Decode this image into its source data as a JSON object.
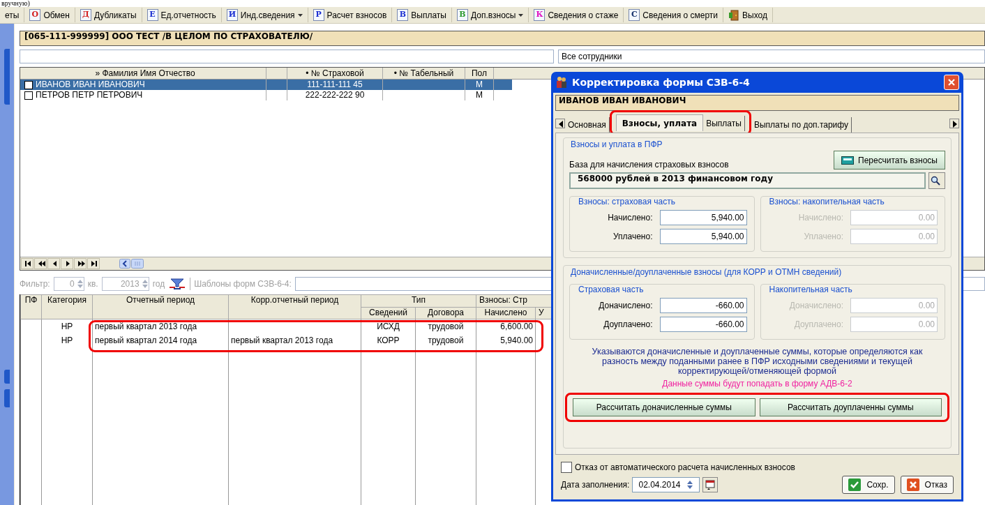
{
  "document_text": "вручную)",
  "toolbar": [
    {
      "kind": "text",
      "label": "еты"
    },
    {
      "kind": "letter",
      "icon_letter": "О",
      "color": "#d42020",
      "label": "Обмен",
      "dropdown": false
    },
    {
      "kind": "letter",
      "icon_letter": "Д",
      "color": "#d42020",
      "label": "Дубликаты",
      "dropdown": false
    },
    {
      "kind": "letter",
      "icon_letter": "Е",
      "color": "#1c2fd0",
      "label": "Ед.отчетность",
      "dropdown": false
    },
    {
      "kind": "letter",
      "icon_letter": "И",
      "color": "#1c2fd0",
      "label": "Инд.сведения",
      "dropdown": true
    },
    {
      "kind": "letter",
      "icon_letter": "Р",
      "color": "#1c2fd0",
      "label": "Расчет взносов",
      "dropdown": false
    },
    {
      "kind": "letter",
      "icon_letter": "В",
      "color": "#1c2fd0",
      "label": "Выплаты",
      "dropdown": false
    },
    {
      "kind": "letter",
      "icon_letter": "В",
      "color": "#2e9a2e",
      "label": "Доп.взносы",
      "dropdown": true
    },
    {
      "kind": "letter",
      "icon_letter": "К",
      "color": "#e010c0",
      "label": "Сведения о стаже",
      "dropdown": false
    },
    {
      "kind": "letter",
      "icon_letter": "С",
      "color": "#14306a",
      "label": "Сведения о смерти",
      "dropdown": false
    },
    {
      "kind": "exit",
      "label": "Выход"
    }
  ],
  "employer_title": "[065-111-999999] ООО ТЕСТ /В ЦЕЛОМ ПО СТРАХОВАТЕЛЮ/",
  "employee_filter": {
    "value": "Все сотрудники"
  },
  "employees": {
    "columns": [
      "» Фамилия Имя Отчество",
      "",
      "• № Страховой",
      "• № Табельный",
      "Пол"
    ],
    "rows": [
      {
        "checked": false,
        "selected": true,
        "name": "ИВАНОВ ИВАН ИВАНОВИЧ",
        "snils": "111-111-111 45",
        "sex": "М"
      },
      {
        "checked": false,
        "selected": false,
        "name": "ПЕТРОВ ПЕТР ПЕТРОВИЧ",
        "snils": "222-222-222 90",
        "sex": "М"
      }
    ]
  },
  "forms_filter": {
    "filter_label": "Фильтр:",
    "quarter": "0",
    "quarter_label": "кв.",
    "year": "2013",
    "year_label": "год",
    "templates_label": "Шаблоны форм СЗВ-6-4:"
  },
  "forms": {
    "header_top": [
      "ПФ",
      "Категория",
      "Отчетный период",
      "Корр.отчетный период",
      "Тип",
      "Взносы: Стр"
    ],
    "header_sub": [
      "Сведений",
      "Договора",
      "Начислено",
      "У"
    ],
    "rows": [
      {
        "category": "НР",
        "period": "первый квартал 2013 года",
        "corr_period": "",
        "info_type": "ИСХД",
        "contract": "трудовой",
        "accrued": "6,600.00"
      },
      {
        "category": "НР",
        "period": "первый квартал 2014 года",
        "corr_period": "первый квартал 2013 года",
        "info_type": "КОРР",
        "contract": "трудовой",
        "accrued": "5,940.00"
      }
    ]
  },
  "dialog": {
    "title": "Корректировка формы СЗВ-6-4",
    "person": "ИВАНОВ ИВАН ИВАНОВИЧ",
    "tabs": [
      {
        "label": "Основная",
        "selected": false
      },
      {
        "label": "Взносы, уплата",
        "selected": true
      },
      {
        "label": "Выплаты",
        "selected": false
      },
      {
        "label": "Выплаты по доп.тарифу",
        "selected": false
      }
    ],
    "pfr_group": {
      "title": "Взносы и уплата в ПФР",
      "recalc_button": "Пересчитать взносы",
      "base_label": "База для начисления страховых взносов",
      "base_value": "568000 рублей в 2013 финансовом году",
      "groups": [
        {
          "title": "Взносы: страховая часть",
          "fields": [
            {
              "label": "Начислено:",
              "value": "5,940.00",
              "disabled": false
            },
            {
              "label": "Уплачено:",
              "value": "5,940.00",
              "disabled": false
            }
          ]
        },
        {
          "title": "Взносы: накопительная часть",
          "fields": [
            {
              "label": "Начислено:",
              "value": "0.00",
              "disabled": true
            },
            {
              "label": "Уплачено:",
              "value": "0.00",
              "disabled": true
            }
          ]
        }
      ]
    },
    "extra_group": {
      "title": "Доначисленные/доуплаченные взносы (для КОРР и ОТМН сведений)",
      "groups": [
        {
          "title": "Страховая часть",
          "fields": [
            {
              "label": "Доначислено:",
              "value": "-660.00",
              "disabled": false
            },
            {
              "label": "Доуплачено:",
              "value": "-660.00",
              "disabled": false
            }
          ]
        },
        {
          "title": "Накопительная часть",
          "fields": [
            {
              "label": "Доначислено:",
              "value": "0.00",
              "disabled": true
            },
            {
              "label": "Доуплачено:",
              "value": "0.00",
              "disabled": true
            }
          ]
        }
      ],
      "note": "Указываются доначисленные и доуплаченные суммы, которые определяются как разность между поданными ранее в ПФР исходными сведениями и текущей корректирующей/отменяющей формой",
      "warning": "Данные суммы будут попадать в форму АДВ-6-2",
      "buttons": [
        "Рассчитать доначисленные суммы",
        "Рассчитать доуплаченны суммы"
      ]
    },
    "auto_refuse": {
      "label": "Отказ от автоматического расчета начисленных взносов",
      "checked": false
    },
    "date_label": "Дата заполнения:",
    "date_value": "02.04.2014",
    "buttons": [
      {
        "kind": "save",
        "label": "Сохр."
      },
      {
        "kind": "cancel",
        "label": "Отказ"
      }
    ]
  }
}
